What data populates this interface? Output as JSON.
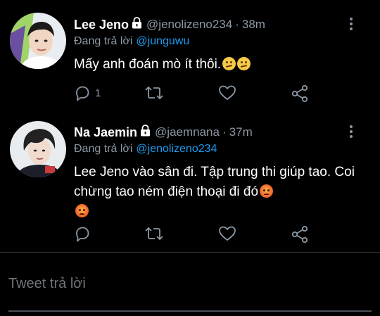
{
  "tweets": [
    {
      "name": "Lee Jeno",
      "handle": "@jenolizeno234",
      "separator": "·",
      "time": "38m",
      "replying_prefix": "Đang trả lời",
      "replying_to": "@junguwu",
      "text": "Mấy anh đoán mò ít thôi.",
      "emojis": [
        "confused-face-icon",
        "confused-face-icon"
      ],
      "reply_count": "1",
      "retweet_count": "",
      "like_count": ""
    },
    {
      "name": "Na Jaemin",
      "handle": "@jaemnana",
      "separator": "·",
      "time": "37m",
      "replying_prefix": "Đang trả lời",
      "replying_to": "@jenolizeno234",
      "text": "Lee Jeno vào sân đi. Tập trung thi giúp tao. Coi chừng tao ném điện thoại đi đó",
      "emojis": [
        "angry-face-icon",
        "angry-face-icon"
      ],
      "reply_count": "",
      "retweet_count": "",
      "like_count": ""
    }
  ],
  "reply_box": {
    "placeholder": "Tweet trả lời"
  },
  "colors": {
    "background": "#000000",
    "secondary_text": "#8b98a5",
    "mention": "#1d9bf0",
    "divider": "#2f3336"
  }
}
